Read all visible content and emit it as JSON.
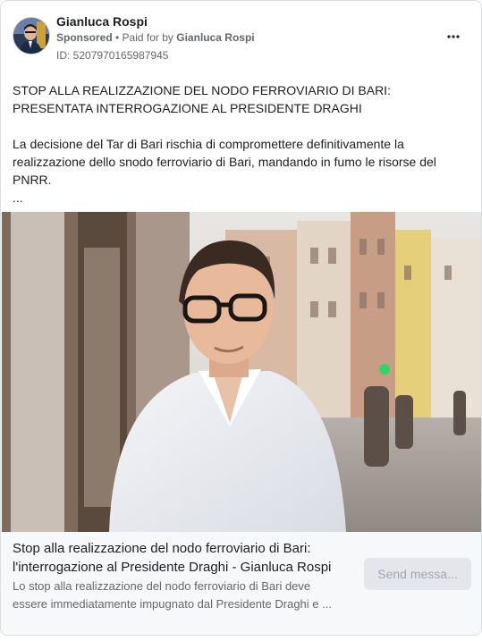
{
  "post": {
    "author_name": "Gianluca Rospi",
    "sponsored_label": "Sponsored",
    "paid_for_prefix": "• Paid for by",
    "paid_for_name": "Gianluca Rospi",
    "ad_id": "ID: 5207970165987945",
    "headline": "STOP ALLA REALIZZAZIONE DEL NODO FERROVIARIO DI BARI: PRESENTATA INTERROGAZIONE AL PRESIDENTE DRAGHI",
    "paragraph": "La decisione del Tar di Bari rischia di compromettere definitivamente la realizzazione dello snodo ferroviario di Bari, mandando in fumo le risorse del PNRR.",
    "ellipsis": "..."
  },
  "link_preview": {
    "title_line1": "Stop alla realizzazione del nodo ferroviario di Bari:",
    "title_line2": "l'interrogazione al Presidente Draghi - Gianluca Rospi",
    "desc_line1": "Lo stop alla realizzazione del nodo ferroviario di Bari deve",
    "desc_line2": "essere immediatamente impugnato dal Presidente Draghi e ...",
    "cta_label": "Send messa..."
  },
  "icons": {
    "more": "more-horizontal-icon",
    "avatar": "profile-photo"
  },
  "colors": {
    "text_primary": "#1c1e21",
    "text_secondary": "#65676b",
    "footer_bg": "#f7f8fa",
    "button_bg": "#e4e6eb",
    "button_text": "#a2a6ad"
  }
}
